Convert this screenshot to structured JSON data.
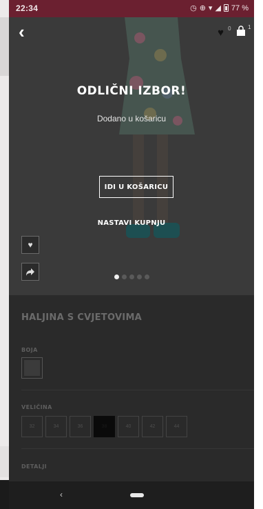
{
  "status_bar": {
    "time": "22:34",
    "battery": "77 %"
  },
  "header": {
    "wishlist_count": "0",
    "cart_count": "1"
  },
  "overlay": {
    "title": "ODLIČNI IZBOR!",
    "subtitle": "Dodano u košaricu",
    "go_to_cart_label": "IDI U KOŠARICU",
    "continue_label": "NASTAVI KUPNJU"
  },
  "gallery": {
    "slide_count": 5,
    "active_slide": 1
  },
  "product": {
    "name": "HALJINA S CVJETOVIMA",
    "color_label": "BOJA",
    "size_label": "VELIČINA",
    "sizes": [
      "32",
      "34",
      "36",
      "38",
      "40",
      "42",
      "44"
    ],
    "selected_size": "38",
    "details_label": "DETALJI"
  },
  "colors": {
    "status_bar": "#6b2030",
    "overlay_dark": "#2a2a2a"
  },
  "icons": {
    "back": "chevron-left-icon",
    "wishlist": "heart-icon",
    "cart": "bag-icon",
    "share": "share-icon",
    "nav_back": "nav-back-icon",
    "nav_home": "nav-home-icon"
  }
}
